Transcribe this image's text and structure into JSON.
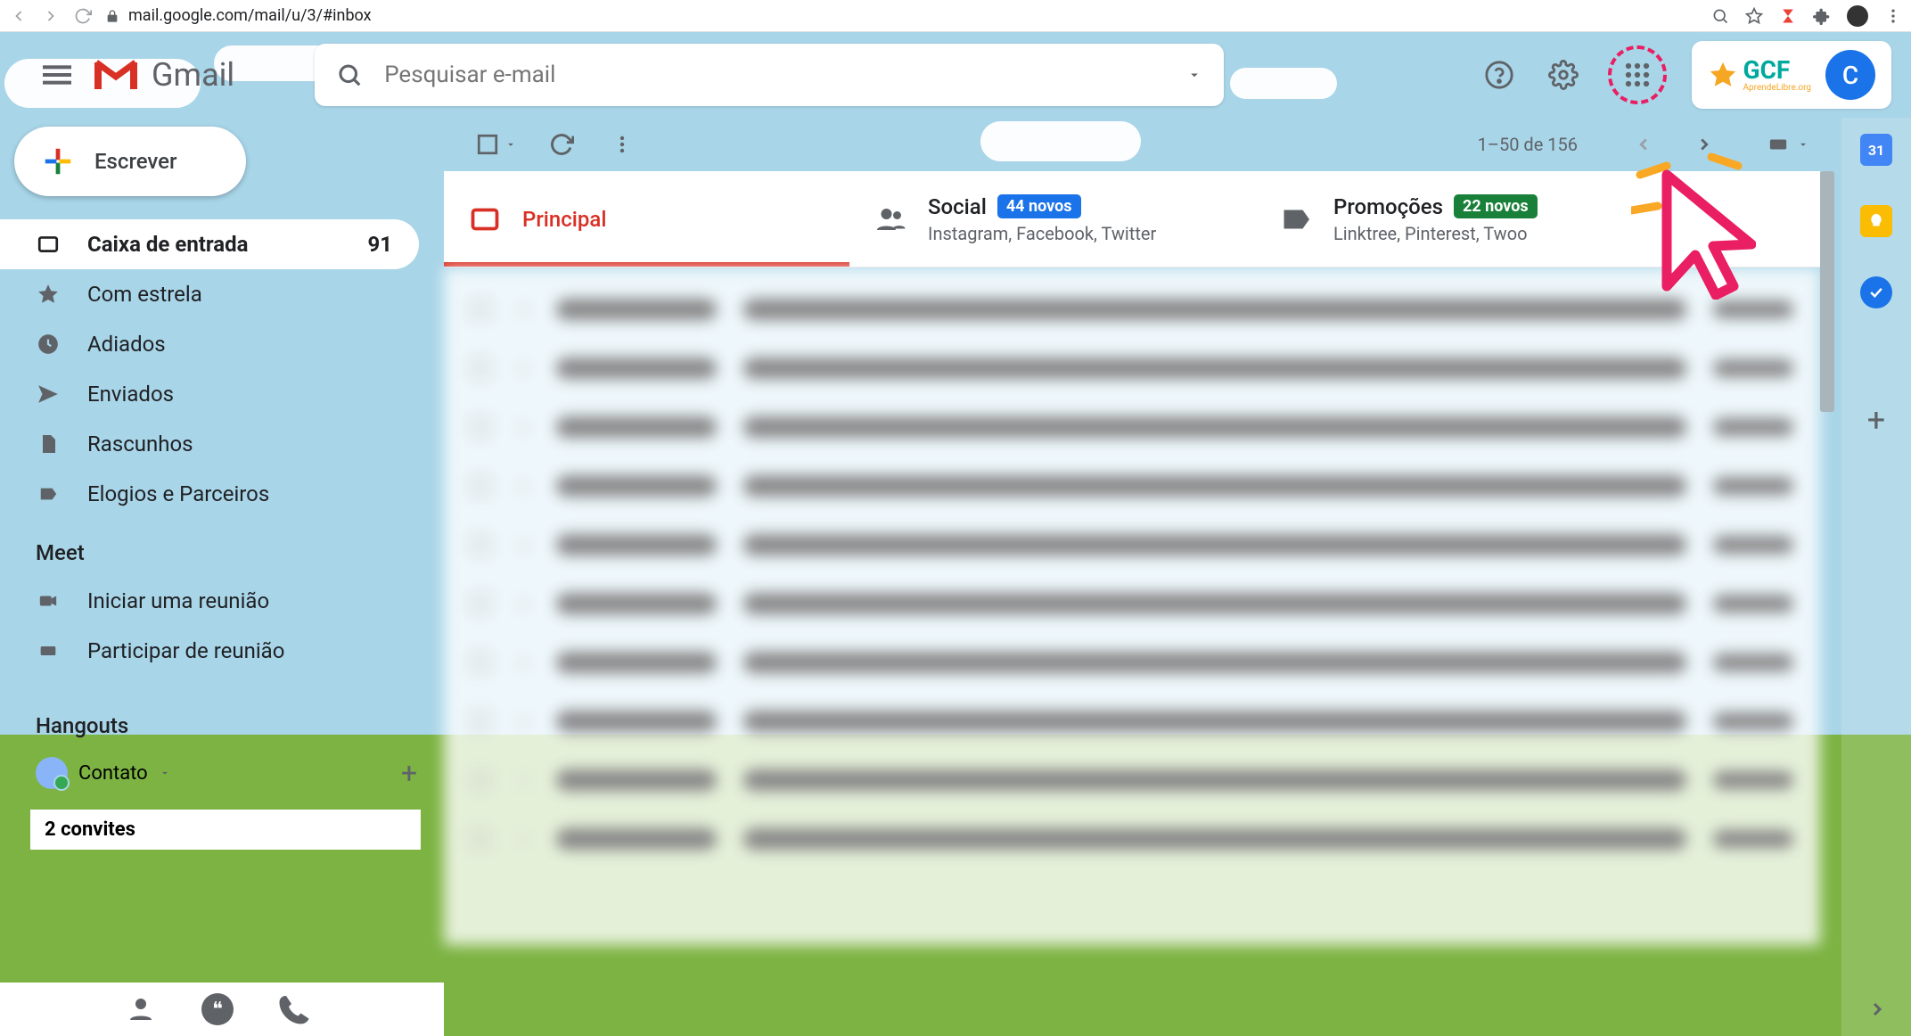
{
  "browser": {
    "url": "mail.google.com/mail/u/3/#inbox"
  },
  "header": {
    "app_name": "Gmail",
    "search_placeholder": "Pesquisar e-mail",
    "brand_text": "GCF",
    "brand_sub": "AprendeLibre.org",
    "avatar_letter": "C"
  },
  "sidebar": {
    "compose_label": "Escrever",
    "items": [
      {
        "label": "Caixa de entrada",
        "count": "91",
        "icon": "inbox",
        "active": true
      },
      {
        "label": "Com estrela",
        "icon": "star"
      },
      {
        "label": "Adiados",
        "icon": "clock"
      },
      {
        "label": "Enviados",
        "icon": "send"
      },
      {
        "label": "Rascunhos",
        "icon": "file"
      },
      {
        "label": "Elogios e Parceiros",
        "icon": "label"
      }
    ],
    "meet_heading": "Meet",
    "meet_items": [
      {
        "label": "Iniciar uma reunião",
        "icon": "video"
      },
      {
        "label": "Participar de reunião",
        "icon": "keyboard"
      }
    ],
    "hangouts_heading": "Hangouts",
    "contact_name": "Contato",
    "invite_title": "2 convites"
  },
  "toolbar": {
    "page_range": "1–50 de 156"
  },
  "tabs": {
    "primary": {
      "label": "Principal"
    },
    "social": {
      "label": "Social",
      "badge": "44 novos",
      "sub": "Instagram, Facebook, Twitter"
    },
    "promo": {
      "label": "Promoções",
      "badge": "22 novos",
      "sub": "Linktree, Pinterest, Twoo"
    }
  },
  "sidepanel": {
    "calendar_day": "31"
  }
}
